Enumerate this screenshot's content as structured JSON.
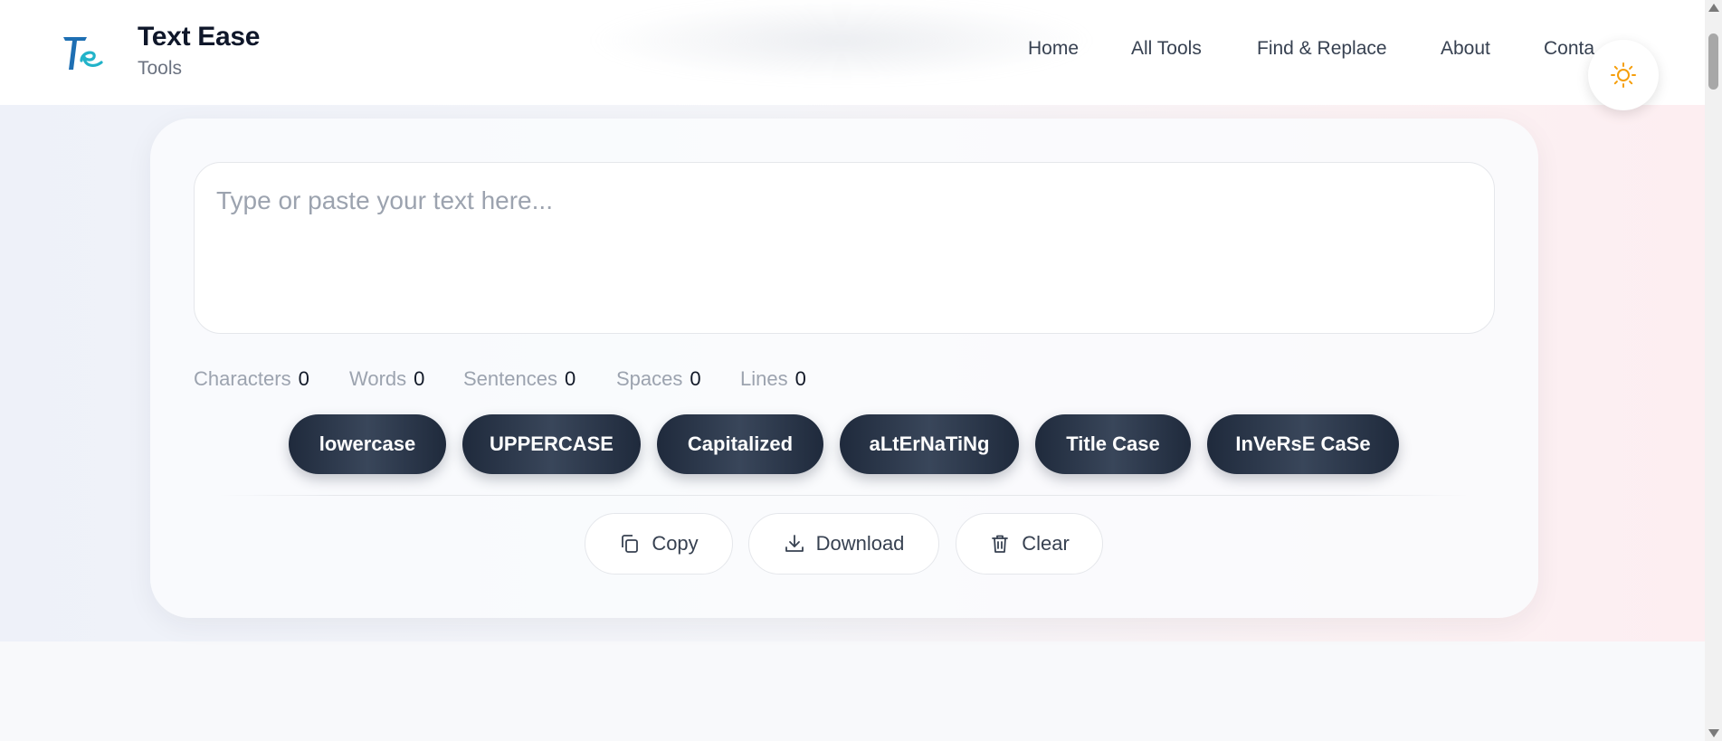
{
  "header": {
    "brand_title": "Text Ease",
    "brand_subtitle": "Tools",
    "logo_icon": "te-monogram-logo",
    "nav": [
      "Home",
      "All Tools",
      "Find & Replace",
      "About",
      "Conta"
    ],
    "theme_toggle_icon": "sun-icon"
  },
  "editor": {
    "placeholder": "Type or paste your text here...",
    "value": ""
  },
  "stats": [
    {
      "label": "Characters",
      "value": "0"
    },
    {
      "label": "Words",
      "value": "0"
    },
    {
      "label": "Sentences",
      "value": "0"
    },
    {
      "label": "Spaces",
      "value": "0"
    },
    {
      "label": "Lines",
      "value": "0"
    }
  ],
  "case_buttons": [
    "lowercase",
    "UPPERCASE",
    "Capitalized",
    "aLtErNaTiNg",
    "Title Case",
    "InVeRsE CaSe"
  ],
  "actions": {
    "copy": {
      "label": "Copy",
      "icon": "copy-icon"
    },
    "download": {
      "label": "Download",
      "icon": "download-icon"
    },
    "clear": {
      "label": "Clear",
      "icon": "trash-icon"
    }
  },
  "colors": {
    "accent_dark": "#1f2a3c",
    "sun": "#f59e0b",
    "logo_blue": "#1e6fb3",
    "logo_teal": "#22b3c9"
  }
}
